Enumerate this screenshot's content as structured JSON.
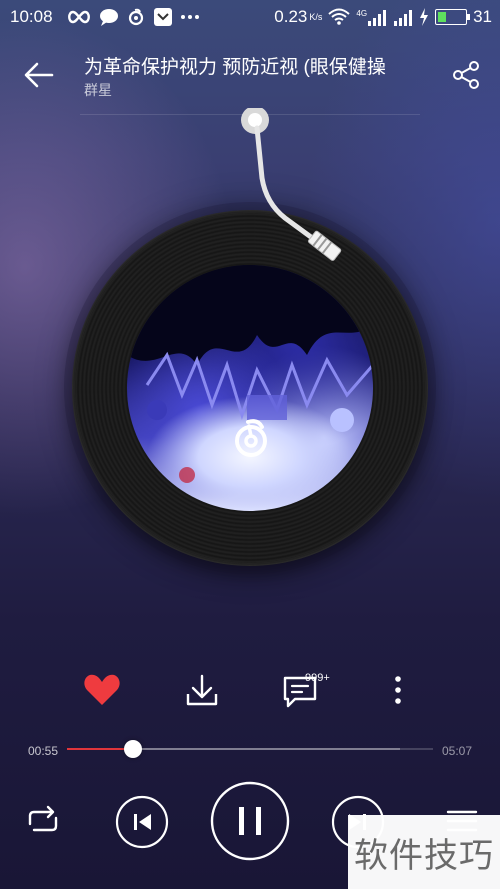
{
  "status_bar": {
    "time": "10:08",
    "net_speed": "0.23",
    "net_unit": "K/s",
    "network_type": "4G",
    "battery": "31",
    "battery_level": 0.31
  },
  "header": {
    "title": "为革命保护视力 预防近视 (眼保健操",
    "artist": "群星"
  },
  "actions": {
    "comment_count": "999+"
  },
  "progress": {
    "current": "00:55",
    "total": "05:07",
    "fraction": 0.18
  },
  "watermark": "软件技巧",
  "colors": {
    "accent": "#e0353b",
    "heart": "#ef3b3f"
  },
  "icons": [
    "back-arrow-icon",
    "share-icon",
    "tonearm-icon",
    "app-logo-icon",
    "heart-icon",
    "download-icon",
    "comment-icon",
    "more-icon",
    "repeat-icon",
    "previous-icon",
    "pause-icon",
    "next-icon",
    "playlist-icon"
  ]
}
